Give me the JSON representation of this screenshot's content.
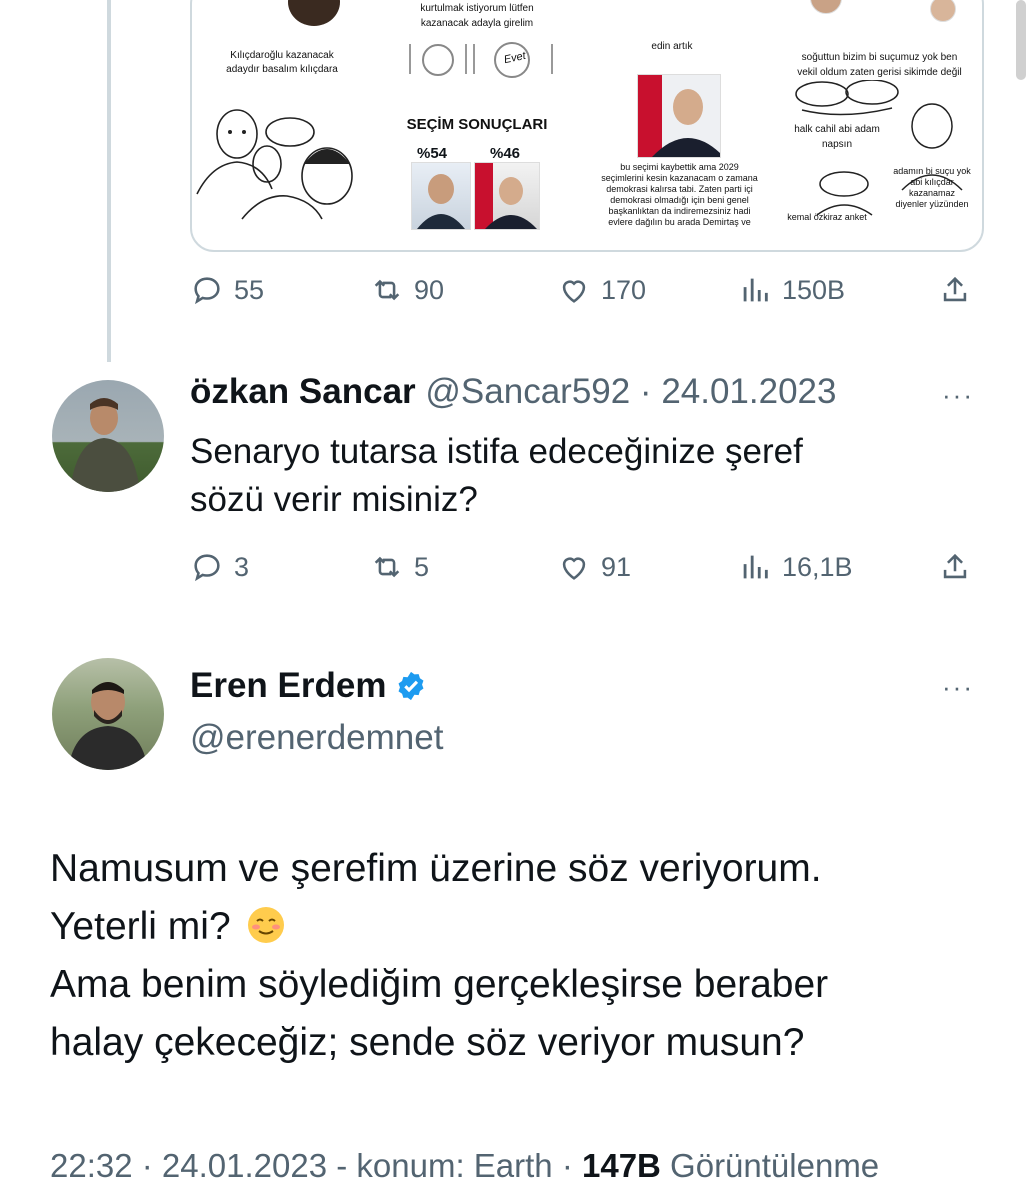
{
  "media": {
    "texts": {
      "t1": "kurtulmak istiyorum lütfen",
      "t2": "kazanacak adayla girelim",
      "t3": "Kılıçdaroğlu kazanacak",
      "t4": "adaydır basalım kılıçdara",
      "t5": "Evet",
      "title": "SEÇİM SONUÇLARI",
      "p1": "%54",
      "p2": "%46",
      "t6": "edin artık",
      "t7": "bu seçimi kaybettik ama 2029",
      "t8": "seçimlerini kesin kazanacam o zamana",
      "t9": "demokrasi kalırsa tabi. Zaten parti içi",
      "t10": "demokrasi olmadığı için beni genel",
      "t11": "başkanlıktan da indiremezsiniz hadi",
      "t12": "evlere dağılın bu arada Demirtaş ve",
      "t13": "soğuttun bizim bi suçumuz yok ben",
      "t14": "vekil oldum zaten gerisi sikimde değil",
      "t15": "halk cahil abi adam",
      "t16": "napsın",
      "t17": "adamın bi suçu yok",
      "t18": "abi kılıçdar",
      "t19": "kazanamaz",
      "t20": "diyenler yüzünden",
      "t21": "kemal özkiraz anket"
    }
  },
  "tweet_actions": {
    "replies": "55",
    "retweets": "90",
    "likes": "170",
    "views": "150B"
  },
  "reply": {
    "name": "özkan Sancar",
    "meta": "@Sancar592 · 24.01.2023",
    "body_line1": "Senaryo tutarsa istifa edeceğinize şeref",
    "body_line2": "sözü verir misiniz?",
    "more": "···",
    "replies": "3",
    "retweets": "5",
    "likes": "91",
    "views": "16,1B"
  },
  "main": {
    "name": "Eren Erdem",
    "handle": "@erenerdemnet",
    "more": "···",
    "line1": "Namusum ve şerefim üzerine söz veriyorum.",
    "line2": "Yeterli mi?",
    "line3": "Ama benim söylediğim gerçekleşirse beraber",
    "line4": "halay çekeceğiz; sende söz veriyor musun?",
    "footer_time": "22:32 · 24.01.2023 - konum: Earth · ",
    "footer_views": "147B",
    "footer_label": " Görüntülenme"
  },
  "icons": {
    "reply": "comment-icon",
    "retweet": "retweet-icon",
    "like": "heart-icon",
    "views": "views-icon",
    "share": "share-icon",
    "verified": "verified-badge-icon"
  },
  "colors": {
    "verified": "#1d9bf0",
    "secondary_text": "#536471",
    "thread_line": "#cfd9de"
  }
}
